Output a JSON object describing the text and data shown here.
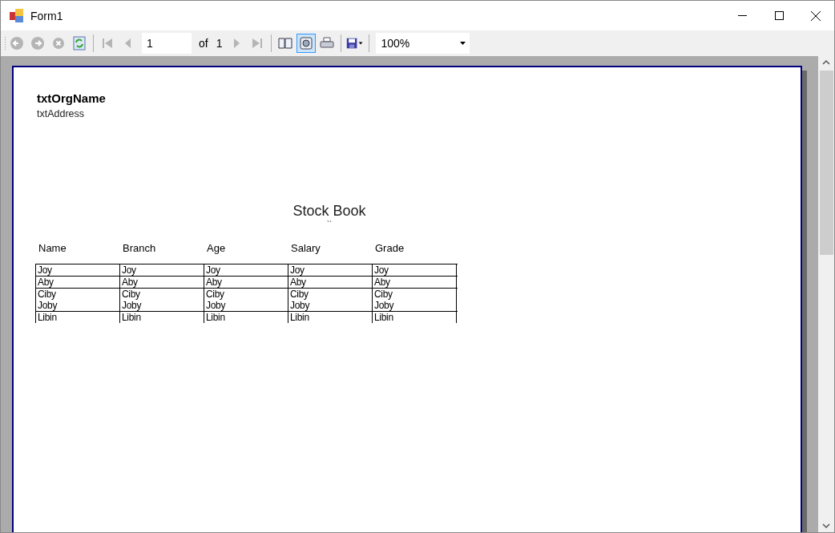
{
  "window": {
    "title": "Form1"
  },
  "toolbar": {
    "buttons": [
      {
        "kind": "back",
        "disabled": true
      },
      {
        "kind": "forward",
        "disabled": true
      },
      {
        "kind": "stop",
        "disabled": true
      },
      {
        "kind": "refresh",
        "disabled": false
      },
      {
        "kind": "sep"
      },
      {
        "kind": "first",
        "disabled": true
      },
      {
        "kind": "prev",
        "disabled": true
      }
    ],
    "page_value": "1",
    "of_label": "of",
    "page_total": "1",
    "buttons_after": [
      {
        "kind": "next",
        "disabled": true
      },
      {
        "kind": "last",
        "disabled": true
      },
      {
        "kind": "sep"
      },
      {
        "kind": "layout",
        "selected": false
      },
      {
        "kind": "pagesetup",
        "selected": true
      },
      {
        "kind": "print",
        "selected": false
      },
      {
        "kind": "sep"
      },
      {
        "kind": "save",
        "selected": false
      },
      {
        "kind": "sep"
      }
    ],
    "zoom": "100%"
  },
  "report": {
    "org_name": "txtOrgName",
    "address": "txtAddress",
    "title": "Stock Book",
    "subtitle": "``",
    "columns": [
      "Name",
      "Branch",
      "Age",
      "Salary",
      "Grade"
    ],
    "rows": [
      {
        "rule_above": true,
        "cells": [
          "Joy",
          "Joy",
          "Joy",
          "Joy",
          "Joy"
        ]
      },
      {
        "rule_above": true,
        "cells": [
          "Aby",
          "Aby",
          "Aby",
          "Aby",
          "Aby"
        ]
      },
      {
        "rule_above": true,
        "cells": [
          "Ciby",
          "Ciby",
          "Ciby",
          "Ciby",
          "Ciby"
        ]
      },
      {
        "rule_above": false,
        "cells": [
          "Joby",
          "Joby",
          "Joby",
          "Joby",
          "Joby"
        ]
      },
      {
        "rule_above": true,
        "cells": [
          "Libin",
          "Libin",
          "Libin",
          "Libin",
          "Libin"
        ]
      }
    ]
  }
}
